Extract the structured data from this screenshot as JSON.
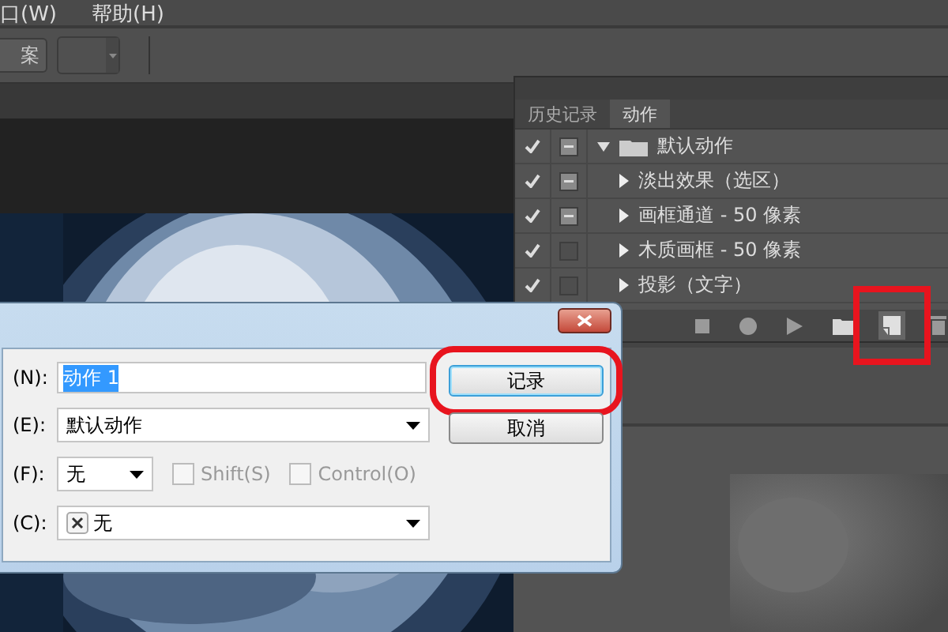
{
  "menu": [
    "口(W)",
    "帮助(H)"
  ],
  "toolbar": {
    "button": "案"
  },
  "panel": {
    "tabs": [
      {
        "label": "历史记录",
        "selected": false
      },
      {
        "label": "动作",
        "selected": true
      }
    ],
    "actions": [
      {
        "label": "默认动作",
        "checked": true,
        "dialog": true,
        "expanded": true,
        "children": [
          {
            "label": "淡出效果（选区）",
            "checked": true,
            "dialog": true,
            "expanded": false
          },
          {
            "label": "画框通道 - 50 像素",
            "checked": true,
            "dialog": true,
            "expanded": false
          },
          {
            "label": "木质画框 - 50 像素",
            "checked": true,
            "dialog": false,
            "expanded": false
          },
          {
            "label": "投影（文字）",
            "checked": true,
            "dialog": false,
            "expanded": false
          }
        ]
      }
    ],
    "tools": [
      {
        "kind": "stop",
        "highlighted": false
      },
      {
        "kind": "record",
        "highlighted": false
      },
      {
        "kind": "play",
        "highlighted": false
      },
      {
        "kind": "folder",
        "highlighted": false
      },
      {
        "kind": "new",
        "highlighted": true
      },
      {
        "kind": "trash",
        "highlighted": false
      }
    ]
  },
  "dialog": {
    "rows": [
      {
        "label": "(N):",
        "kind": "text",
        "value": "动作 1"
      },
      {
        "label": "(E):",
        "kind": "select",
        "value": "默认动作"
      },
      {
        "label": "(F):",
        "kind": "key",
        "value": "无",
        "checkboxes": [
          {
            "label": "Shift(S)",
            "checked": false
          },
          {
            "label": "Control(O)",
            "checked": false
          }
        ]
      },
      {
        "label": "(C):",
        "kind": "color",
        "value": "无"
      }
    ],
    "buttons": [
      {
        "label": "记录",
        "default": true,
        "highlighted": true
      },
      {
        "label": "取消",
        "default": false,
        "highlighted": false
      }
    ]
  }
}
